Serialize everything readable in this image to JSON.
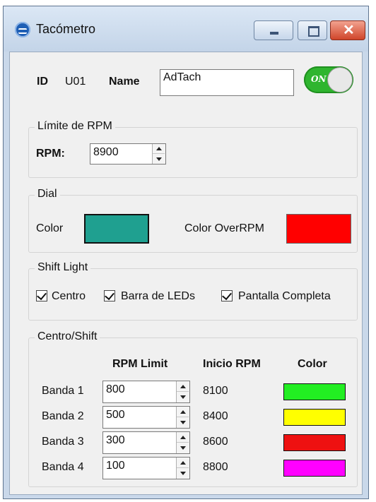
{
  "window": {
    "title": "Tacómetro",
    "colors": {
      "frame": "#c9d8ea",
      "client": "#f0f0f0",
      "close": "#d0452a"
    }
  },
  "header": {
    "id_label": "ID",
    "id_value": "U01",
    "name_label": "Name",
    "name_value": "AdTach",
    "toggle_text": "ON",
    "toggle_on": true,
    "toggle_color": "#2fb52f"
  },
  "rpm_limit": {
    "group_title": "Límite de RPM",
    "rpm_label": "RPM:",
    "rpm_value": "8900"
  },
  "dial": {
    "group_title": "Dial",
    "color_label": "Color",
    "color": "#1fa090",
    "over_label": "Color OverRPM",
    "over_color": "#ff0000"
  },
  "shift_light": {
    "group_title": "Shift Light",
    "options": [
      {
        "label": "Centro",
        "checked": true
      },
      {
        "label": "Barra de LEDs",
        "checked": true
      },
      {
        "label": "Pantalla Completa",
        "checked": true
      }
    ]
  },
  "centro_shift": {
    "group_title": "Centro/Shift",
    "headers": {
      "limit": "RPM Limit",
      "inicio": "Inicio RPM",
      "color": "Color"
    },
    "bands": [
      {
        "label": "Banda 1",
        "limit": "800",
        "inicio": "8100",
        "color": "#22ee22"
      },
      {
        "label": "Banda 2",
        "limit": "500",
        "inicio": "8400",
        "color": "#ffff00"
      },
      {
        "label": "Banda 3",
        "limit": "300",
        "inicio": "8600",
        "color": "#ee1111"
      },
      {
        "label": "Banda 4",
        "limit": "100",
        "inicio": "8800",
        "color": "#ff00ff"
      }
    ]
  }
}
